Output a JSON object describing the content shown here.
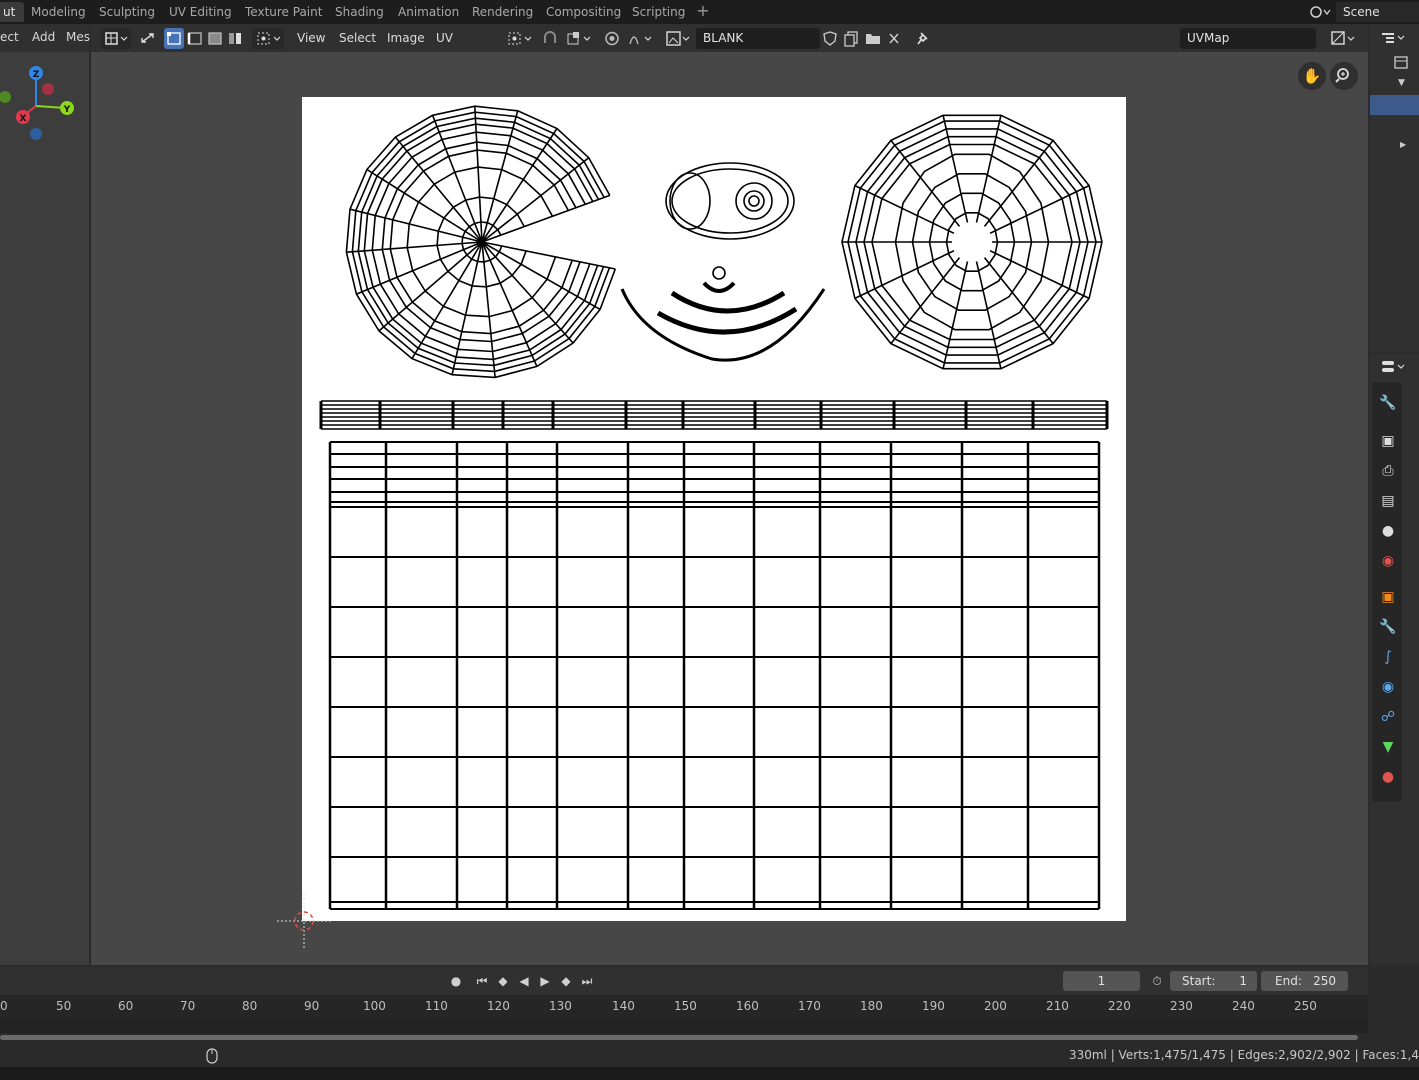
{
  "workspace_tabs": [
    "ut",
    "Modeling",
    "Sculpting",
    "UV Editing",
    "Texture Paint",
    "Shading",
    "Animation",
    "Rendering",
    "Compositing",
    "Scripting"
  ],
  "active_tab": "ut",
  "add_tab": "+",
  "scene": {
    "label": "Scene"
  },
  "viewport3d": {
    "menus": [
      "ect",
      "Add",
      "Mes"
    ],
    "gizmo": {
      "z": "Z",
      "y": "Y",
      "x": "X"
    }
  },
  "uv_editor": {
    "menus": [
      "View",
      "Select",
      "Image",
      "UV"
    ],
    "image_name": "BLANK",
    "uvmap_name": "UVMap"
  },
  "timeline": {
    "current_frame": "1",
    "start_label": "Start:",
    "start_value": "1",
    "end_label": "End:",
    "end_value": "250",
    "ticks": [
      "0",
      "50",
      "60",
      "70",
      "80",
      "90",
      "100",
      "110",
      "120",
      "130",
      "140",
      "150",
      "160",
      "170",
      "180",
      "190",
      "200",
      "210",
      "220",
      "230",
      "240",
      "250"
    ]
  },
  "status": {
    "text": "330ml | Verts:1,475/1,475 | Edges:2,902/2,902 | Faces:1,4"
  },
  "colors": {
    "accent_blue": "#4772b3",
    "axis_x": "#e0384e",
    "axis_y": "#8bd61f",
    "axis_z": "#2f86e8"
  }
}
